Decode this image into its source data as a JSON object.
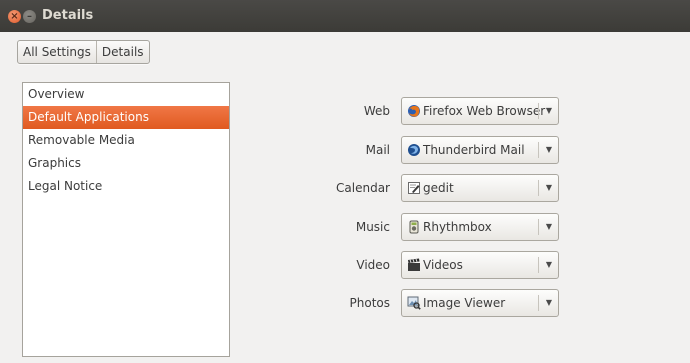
{
  "window": {
    "title": "Details",
    "close_glyph": "×",
    "minimize_glyph": "–"
  },
  "breadcrumb": {
    "items": [
      "All Settings",
      "Details"
    ]
  },
  "sidebar": {
    "items": [
      {
        "label": "Overview",
        "selected": false
      },
      {
        "label": "Default Applications",
        "selected": true
      },
      {
        "label": "Removable Media",
        "selected": false
      },
      {
        "label": "Graphics",
        "selected": false
      },
      {
        "label": "Legal Notice",
        "selected": false
      }
    ],
    "selected_color": "#e9662c"
  },
  "defaults": {
    "rows": [
      {
        "label": "Web",
        "app": "Firefox Web Browser",
        "icon": "firefox-icon"
      },
      {
        "label": "Mail",
        "app": "Thunderbird Mail",
        "icon": "thunderbird-icon"
      },
      {
        "label": "Calendar",
        "app": "gedit",
        "icon": "gedit-icon"
      },
      {
        "label": "Music",
        "app": "Rhythmbox",
        "icon": "rhythmbox-icon"
      },
      {
        "label": "Video",
        "app": "Videos",
        "icon": "videos-icon"
      },
      {
        "label": "Photos",
        "app": "Image Viewer",
        "icon": "image-viewer-icon"
      }
    ],
    "dropdown_arrow": "▼"
  }
}
